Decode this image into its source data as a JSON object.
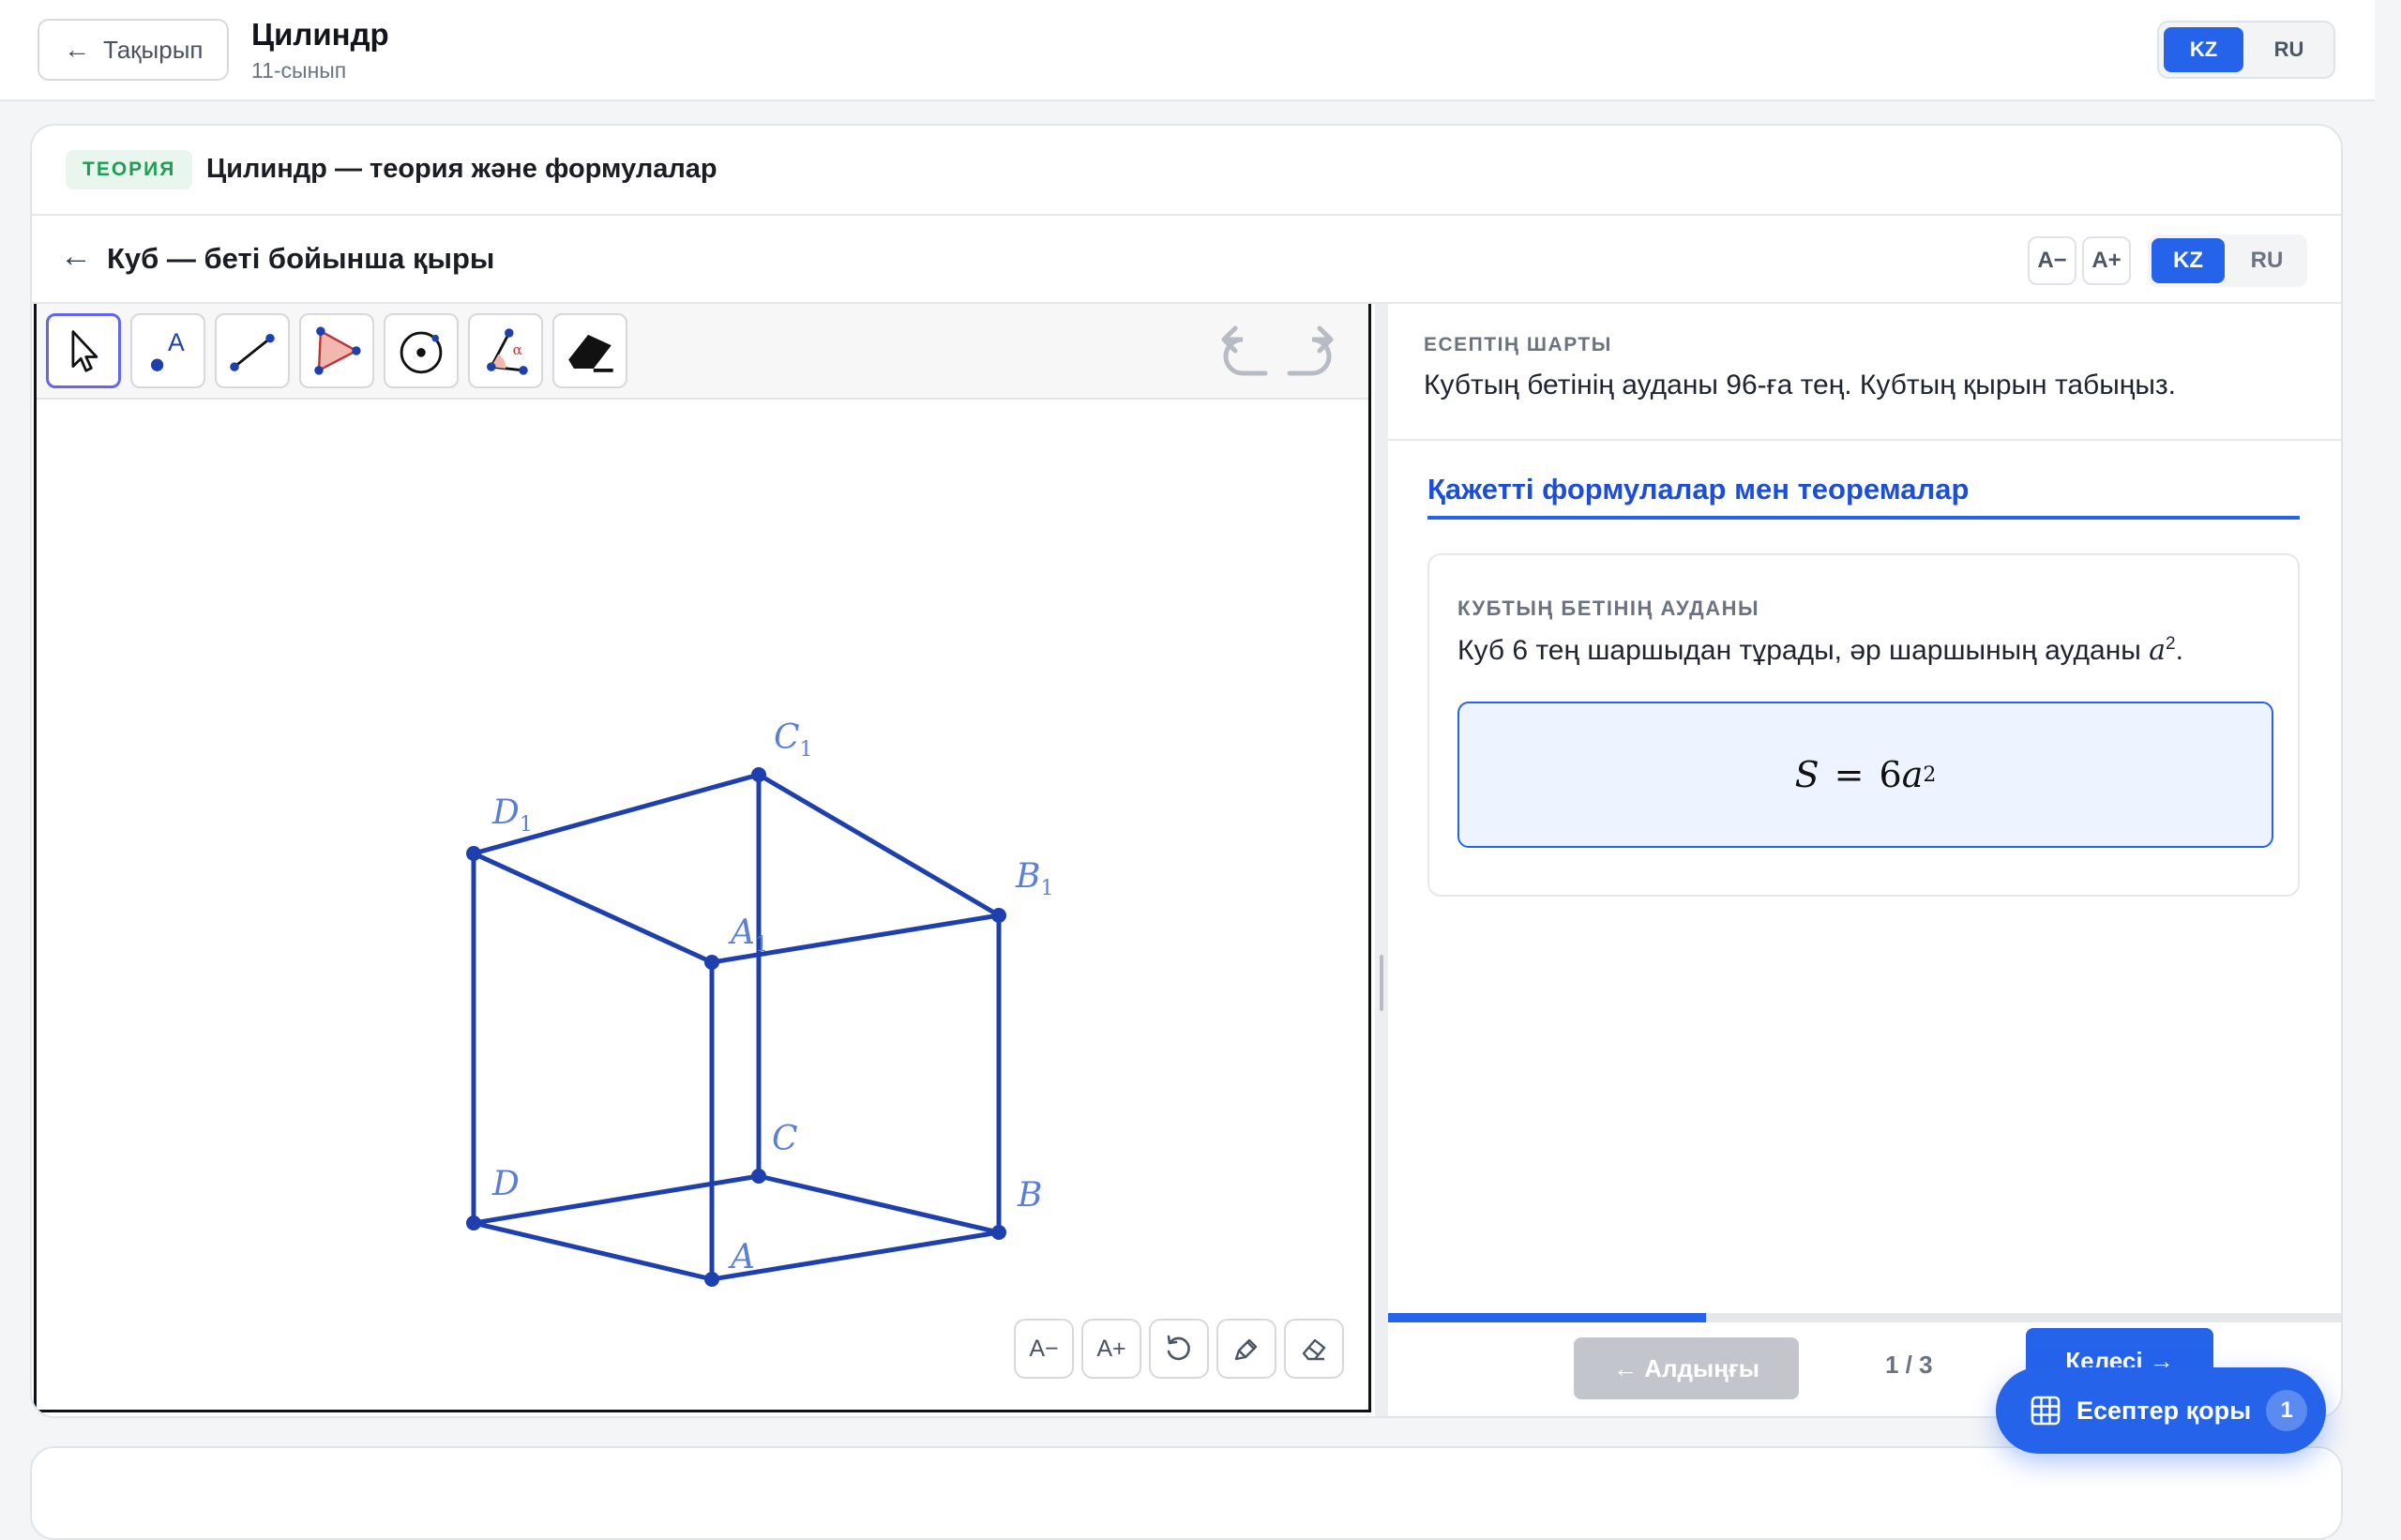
{
  "header": {
    "back_label": "Тақырып",
    "title": "Цилиндр",
    "subtitle": "11-сынып",
    "lang_options": [
      "KZ",
      "RU"
    ],
    "lang_active": "KZ"
  },
  "theory": {
    "badge": "ТЕОРИЯ",
    "title": "Цилиндр — теория және формулалар"
  },
  "task": {
    "back_arrow": "←",
    "title": "Куб — беті бойынша қыры",
    "font_decrease": "A−",
    "font_increase": "A+",
    "lang_options": [
      "KZ",
      "RU"
    ],
    "lang_active": "KZ"
  },
  "geometry": {
    "tools": [
      "move-tool",
      "point-tool",
      "segment-tool",
      "polygon-tool",
      "circle-tool",
      "angle-tool",
      "eraser-tool"
    ],
    "bottom_controls": {
      "font_decrease": "A−",
      "font_increase": "A+"
    },
    "color": "#1e40af",
    "label_color": "#5b7fd6",
    "vertices": [
      {
        "name": "A",
        "sub": ""
      },
      {
        "name": "B",
        "sub": ""
      },
      {
        "name": "C",
        "sub": ""
      },
      {
        "name": "D",
        "sub": ""
      },
      {
        "name": "A",
        "sub": "1"
      },
      {
        "name": "B",
        "sub": "1"
      },
      {
        "name": "C",
        "sub": "1"
      },
      {
        "name": "D",
        "sub": "1"
      }
    ]
  },
  "problem": {
    "label": "ЕСЕПТІҢ ШАРТЫ",
    "text": "Кубтың бетінің ауданы 96-ға тең. Кубтың қырын табыңыз."
  },
  "formulas": {
    "section_title": "Қажетті формулалар мен теоремалар",
    "card_label": "КУБТЫҢ БЕТІНІҢ АУДАНЫ",
    "card_text_before": "Куб 6 тең шаршыдан тұрады, әр шаршының ауданы ",
    "card_text_var": "a",
    "card_text_exp": "2",
    "card_text_after": ".",
    "formula": {
      "lhs": "S",
      "eq": "=",
      "coef": "6",
      "var": "a",
      "exp": "2"
    }
  },
  "navigation": {
    "prev_label": "← Алдыңғы",
    "next_label": "Келесі →",
    "pager": "1 / 3",
    "progress_fraction": 0.333
  },
  "task_bank": {
    "label": "Есептер қоры",
    "count": "1"
  },
  "colors": {
    "accent": "#2563eb",
    "theory_badge": "#1f9d55",
    "figure": "#1e40af"
  }
}
